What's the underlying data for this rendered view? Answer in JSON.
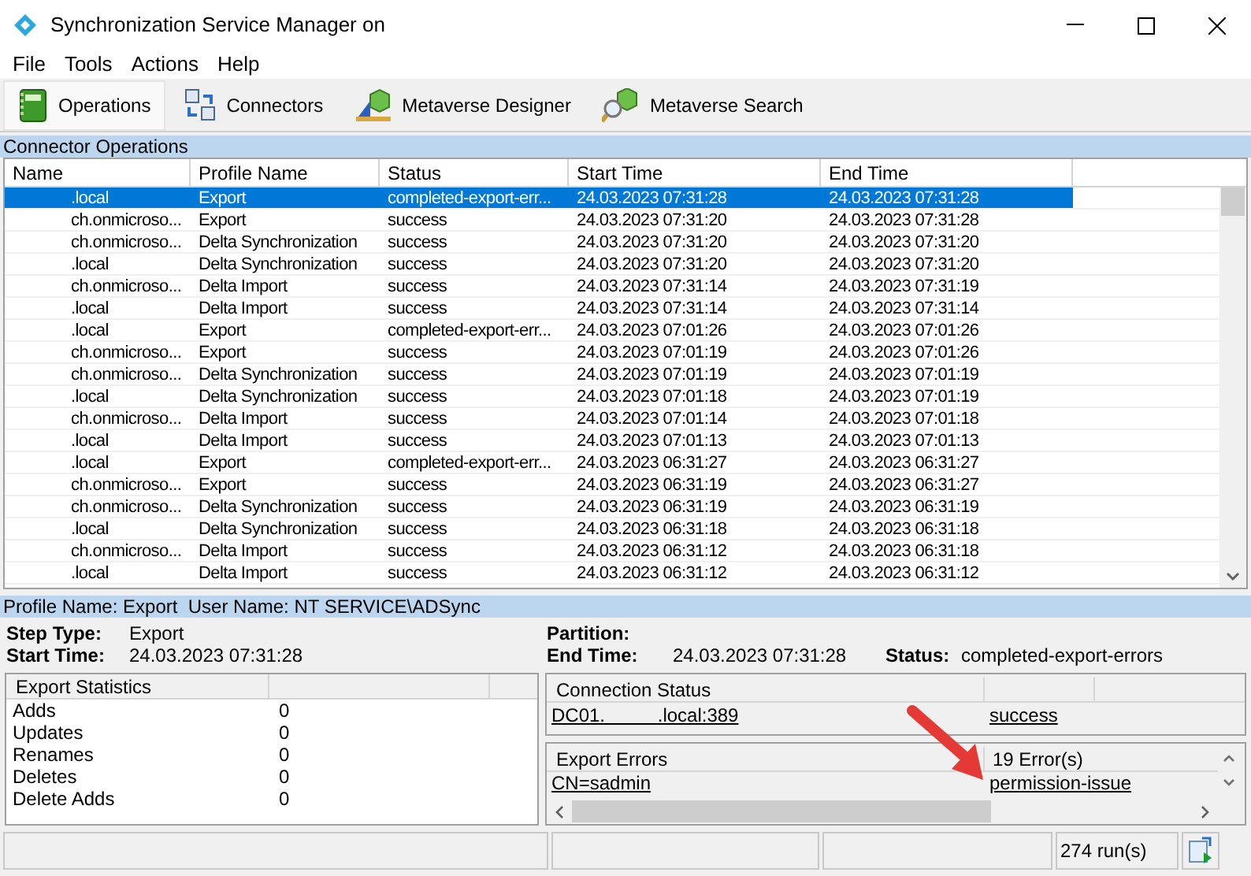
{
  "window": {
    "title": "Synchronization Service Manager on"
  },
  "menu": [
    "File",
    "Tools",
    "Actions",
    "Help"
  ],
  "toolbar": [
    {
      "label": "Operations",
      "selected": true,
      "kind": "operations"
    },
    {
      "label": "Connectors",
      "selected": false,
      "kind": "connectors"
    },
    {
      "label": "Metaverse Designer",
      "selected": false,
      "kind": "designer"
    },
    {
      "label": "Metaverse Search",
      "selected": false,
      "kind": "search"
    }
  ],
  "operations": {
    "title": "Connector Operations",
    "columns": [
      "Name",
      "Profile Name",
      "Status",
      "Start Time",
      "End Time"
    ],
    "rows": [
      {
        "selected": true,
        "cells": [
          ".local",
          "Export",
          "completed-export-err...",
          "24.03.2023 07:31:28",
          "24.03.2023 07:31:28"
        ]
      },
      {
        "selected": false,
        "cells": [
          "ch.onmicroso...",
          "Export",
          "success",
          "24.03.2023 07:31:20",
          "24.03.2023 07:31:28"
        ]
      },
      {
        "selected": false,
        "cells": [
          "ch.onmicroso...",
          "Delta Synchronization",
          "success",
          "24.03.2023 07:31:20",
          "24.03.2023 07:31:20"
        ]
      },
      {
        "selected": false,
        "cells": [
          ".local",
          "Delta Synchronization",
          "success",
          "24.03.2023 07:31:20",
          "24.03.2023 07:31:20"
        ]
      },
      {
        "selected": false,
        "cells": [
          "ch.onmicroso...",
          "Delta Import",
          "success",
          "24.03.2023 07:31:14",
          "24.03.2023 07:31:19"
        ]
      },
      {
        "selected": false,
        "cells": [
          ".local",
          "Delta Import",
          "success",
          "24.03.2023 07:31:14",
          "24.03.2023 07:31:14"
        ]
      },
      {
        "selected": false,
        "cells": [
          ".local",
          "Export",
          "completed-export-err...",
          "24.03.2023 07:01:26",
          "24.03.2023 07:01:26"
        ]
      },
      {
        "selected": false,
        "cells": [
          "ch.onmicroso...",
          "Export",
          "success",
          "24.03.2023 07:01:19",
          "24.03.2023 07:01:26"
        ]
      },
      {
        "selected": false,
        "cells": [
          "ch.onmicroso...",
          "Delta Synchronization",
          "success",
          "24.03.2023 07:01:19",
          "24.03.2023 07:01:19"
        ]
      },
      {
        "selected": false,
        "cells": [
          ".local",
          "Delta Synchronization",
          "success",
          "24.03.2023 07:01:18",
          "24.03.2023 07:01:19"
        ]
      },
      {
        "selected": false,
        "cells": [
          "ch.onmicroso...",
          "Delta Import",
          "success",
          "24.03.2023 07:01:14",
          "24.03.2023 07:01:18"
        ]
      },
      {
        "selected": false,
        "cells": [
          ".local",
          "Delta Import",
          "success",
          "24.03.2023 07:01:13",
          "24.03.2023 07:01:13"
        ]
      },
      {
        "selected": false,
        "cells": [
          ".local",
          "Export",
          "completed-export-err...",
          "24.03.2023 06:31:27",
          "24.03.2023 06:31:27"
        ]
      },
      {
        "selected": false,
        "cells": [
          "ch.onmicroso...",
          "Export",
          "success",
          "24.03.2023 06:31:19",
          "24.03.2023 06:31:27"
        ]
      },
      {
        "selected": false,
        "cells": [
          "ch.onmicroso...",
          "Delta Synchronization",
          "success",
          "24.03.2023 06:31:19",
          "24.03.2023 06:31:19"
        ]
      },
      {
        "selected": false,
        "cells": [
          ".local",
          "Delta Synchronization",
          "success",
          "24.03.2023 06:31:18",
          "24.03.2023 06:31:18"
        ]
      },
      {
        "selected": false,
        "cells": [
          "ch.onmicroso...",
          "Delta Import",
          "success",
          "24.03.2023 06:31:12",
          "24.03.2023 06:31:18"
        ]
      },
      {
        "selected": false,
        "cells": [
          ".local",
          "Delta Import",
          "success",
          "24.03.2023 06:31:12",
          "24.03.2023 06:31:12"
        ]
      }
    ]
  },
  "details": {
    "header": "Profile Name: Export  User Name: NT SERVICE\\ADSync",
    "step_type_label": "Step Type:",
    "step_type": "Export",
    "start_time_label": "Start Time:",
    "start_time": "24.03.2023 07:31:28",
    "partition_label": "Partition:",
    "end_time_label": "End Time:",
    "end_time": "24.03.2023 07:31:28",
    "status_label": "Status:",
    "status": "completed-export-errors"
  },
  "export_statistics": {
    "title": "Export Statistics",
    "rows": [
      {
        "label": "Adds",
        "value": "0"
      },
      {
        "label": "Updates",
        "value": "0"
      },
      {
        "label": "Renames",
        "value": "0"
      },
      {
        "label": "Deletes",
        "value": "0"
      },
      {
        "label": "Delete Adds",
        "value": "0"
      }
    ]
  },
  "connection_status": {
    "title": "Connection Status",
    "rows": [
      {
        "server": "DC01.          .local:389",
        "result": "success"
      }
    ]
  },
  "export_errors": {
    "title": "Export Errors",
    "count": "19 Error(s)",
    "rows": [
      {
        "object": "CN=sadmin",
        "error": "permission-issue"
      }
    ]
  },
  "status_bar": {
    "runs": "274 run(s)"
  }
}
